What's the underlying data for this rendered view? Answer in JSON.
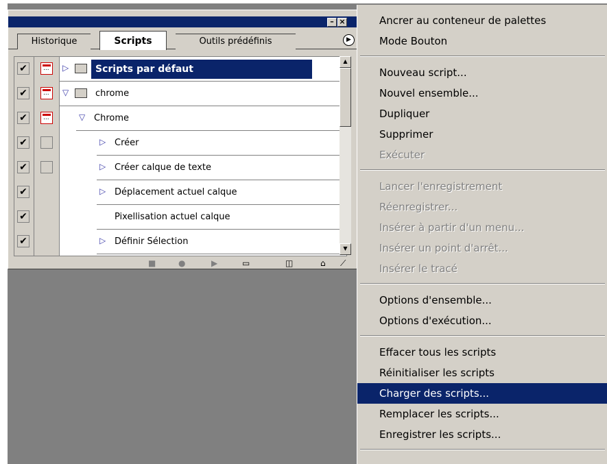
{
  "panel": {
    "tabs": [
      {
        "label": "Historique",
        "active": false
      },
      {
        "label": "Scripts",
        "active": true
      },
      {
        "label": "Outils prédéfinis",
        "active": false
      }
    ],
    "rows": [
      {
        "label": "Scripts par défaut",
        "indent": 0,
        "expanded": false,
        "folder": true,
        "checked": true,
        "dialog": true,
        "selected": true
      },
      {
        "label": "chrome",
        "indent": 0,
        "expanded": true,
        "folder": true,
        "checked": true,
        "dialog": true,
        "selected": false
      },
      {
        "label": "Chrome",
        "indent": 1,
        "expanded": true,
        "folder": false,
        "checked": true,
        "dialog": true,
        "selected": false
      },
      {
        "label": "Créer",
        "indent": 2,
        "expanded": false,
        "folder": false,
        "checked": true,
        "dialog": false,
        "selected": false
      },
      {
        "label": "Créer calque de texte",
        "indent": 2,
        "expanded": false,
        "folder": false,
        "checked": true,
        "dialog": false,
        "selected": false
      },
      {
        "label": "Déplacement actuel calque",
        "indent": 2,
        "expanded": false,
        "folder": false,
        "checked": true,
        "dialog": false,
        "selected": false
      },
      {
        "label": "Pixellisation actuel calque",
        "indent": 2,
        "expanded": null,
        "folder": false,
        "checked": true,
        "dialog": false,
        "selected": false
      },
      {
        "label": "Définir Sélection",
        "indent": 2,
        "expanded": false,
        "folder": false,
        "checked": true,
        "dialog": false,
        "selected": false
      }
    ],
    "toolbar_icons": [
      "stop-icon",
      "record-icon",
      "play-icon",
      "folder-icon",
      "new-script-icon",
      "trash-icon"
    ]
  },
  "menu": {
    "groups": [
      [
        {
          "label": "Ancrer au conteneur de palettes",
          "enabled": true
        },
        {
          "label": "Mode Bouton",
          "enabled": true
        }
      ],
      [
        {
          "label": "Nouveau script...",
          "enabled": true
        },
        {
          "label": "Nouvel ensemble...",
          "enabled": true
        },
        {
          "label": "Dupliquer",
          "enabled": true
        },
        {
          "label": "Supprimer",
          "enabled": true
        },
        {
          "label": "Exécuter",
          "enabled": false
        }
      ],
      [
        {
          "label": "Lancer l'enregistrement",
          "enabled": false
        },
        {
          "label": "Réenregistrer...",
          "enabled": false
        },
        {
          "label": "Insérer à partir d'un menu...",
          "enabled": false
        },
        {
          "label": "Insérer un point d'arrêt...",
          "enabled": false
        },
        {
          "label": "Insérer le tracé",
          "enabled": false
        }
      ],
      [
        {
          "label": "Options d'ensemble...",
          "enabled": true
        },
        {
          "label": "Options d'exécution...",
          "enabled": true
        }
      ],
      [
        {
          "label": "Effacer tous les scripts",
          "enabled": true
        },
        {
          "label": "Réinitialiser les scripts",
          "enabled": true
        },
        {
          "label": "Charger des scripts...",
          "enabled": true,
          "highlighted": true
        },
        {
          "label": "Remplacer les scripts...",
          "enabled": true
        },
        {
          "label": "Enregistrer les scripts...",
          "enabled": true
        }
      ]
    ]
  }
}
